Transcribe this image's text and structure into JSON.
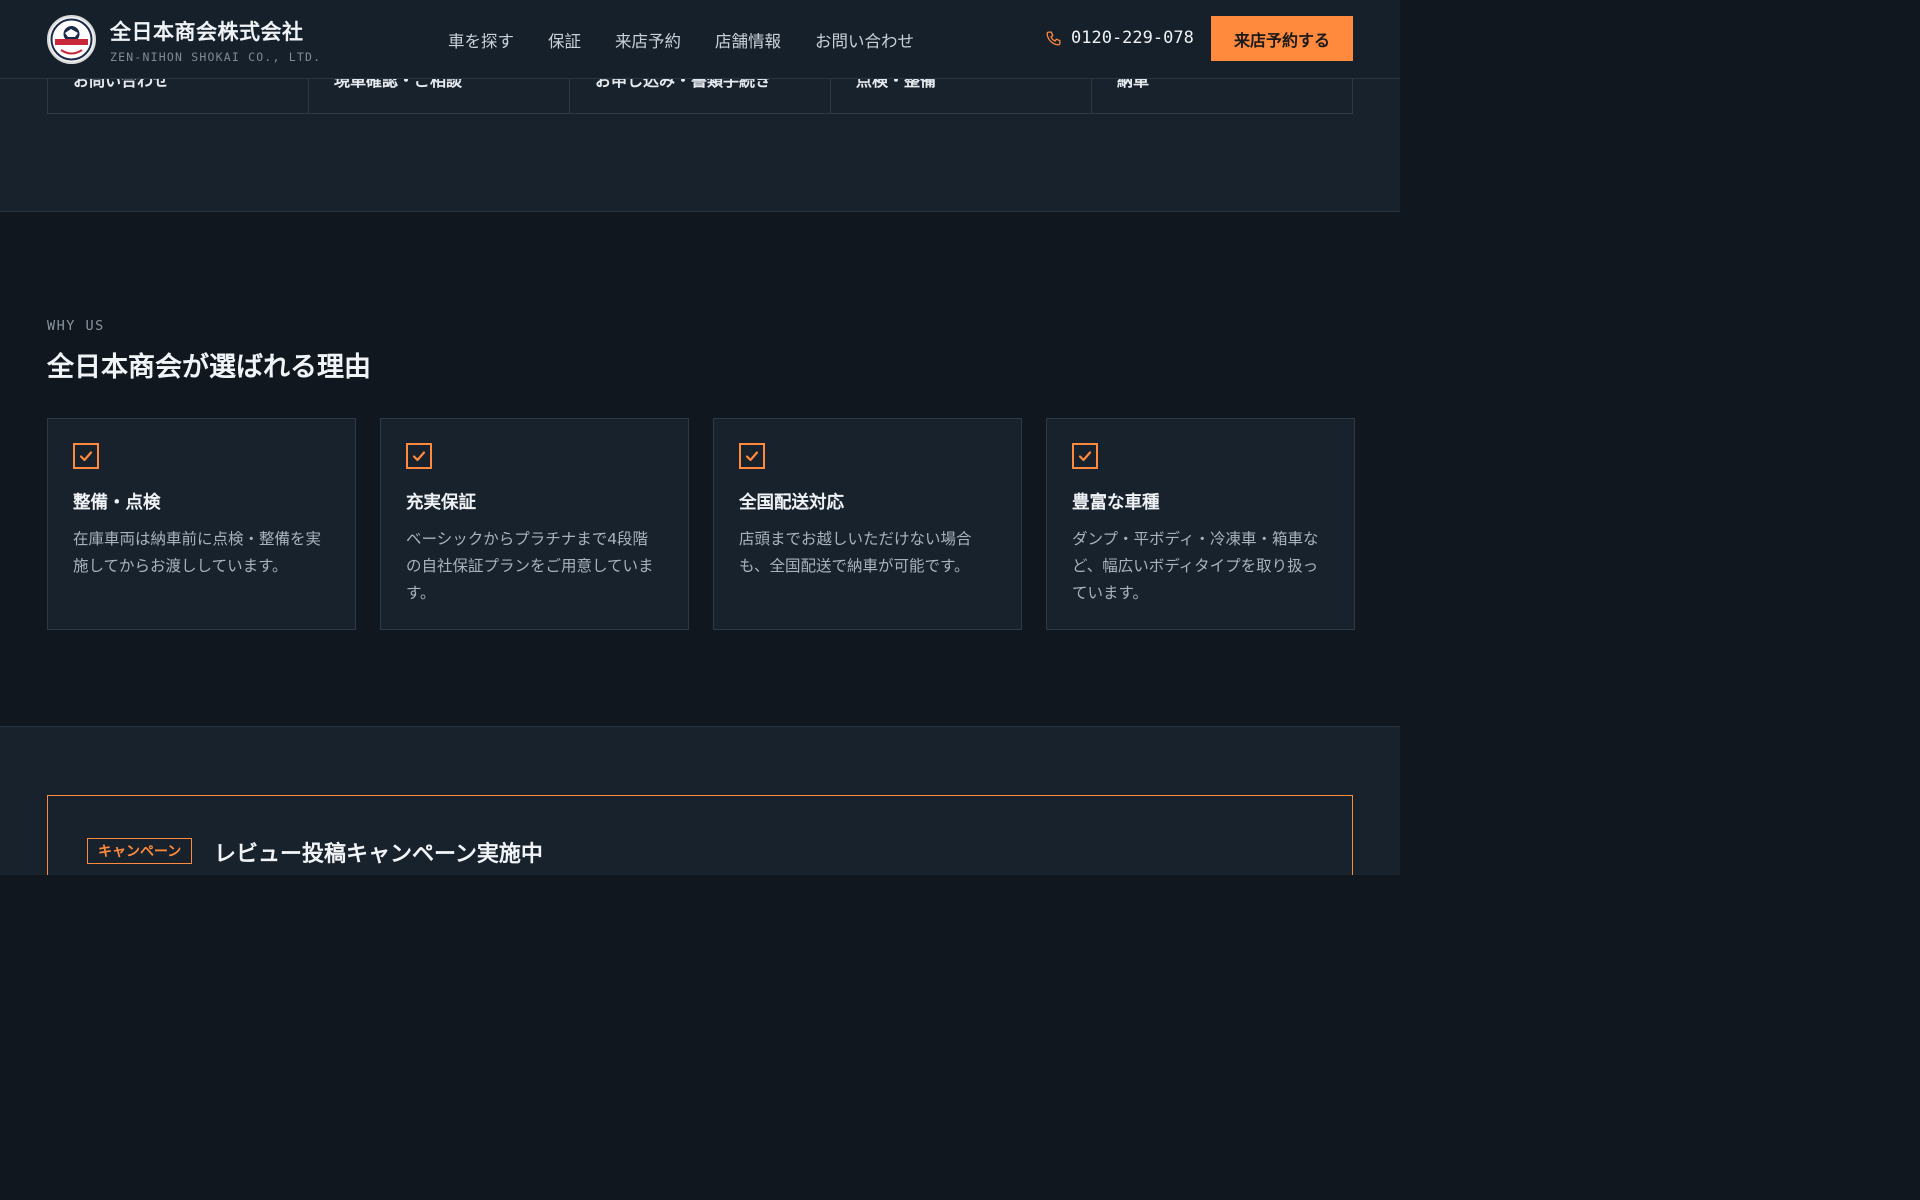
{
  "brand": {
    "name": "全日本商会株式会社",
    "sub": "ZEN-NIHON SHOKAI CO., LTD.",
    "logo_text": "ZEN-NIHON"
  },
  "nav": {
    "items": [
      "車を探す",
      "保証",
      "来店予約",
      "店舗情報",
      "お問い合わせ"
    ]
  },
  "header": {
    "phone": "0120-229-078",
    "cta_label": "来店予約する"
  },
  "steps": [
    "お問い合わせ",
    "現車確認・ご相談",
    "お申し込み・書類手続き",
    "点検・整備",
    "納車"
  ],
  "why": {
    "eyebrow": "WHY US",
    "title": "全日本商会が選ばれる理由",
    "cards": [
      {
        "title": "整備・点検",
        "text": "在庫車両は納車前に点検・整備を実施してからお渡ししています。"
      },
      {
        "title": "充実保証",
        "text": "ベーシックからプラチナまで4段階の自社保証プランをご用意しています。"
      },
      {
        "title": "全国配送対応",
        "text": "店頭までお越しいただけない場合も、全国配送で納車が可能です。"
      },
      {
        "title": "豊富な車種",
        "text": "ダンプ・平ボディ・冷凍車・箱車など、幅広いボディタイプを取り扱っています。"
      }
    ]
  },
  "campaign": {
    "badge": "キャンペーン",
    "title": "レビュー投稿キャンペーン実施中"
  },
  "colors": {
    "accent": "#ff8a3d",
    "background": "#10171f",
    "panel": "#18222c"
  }
}
